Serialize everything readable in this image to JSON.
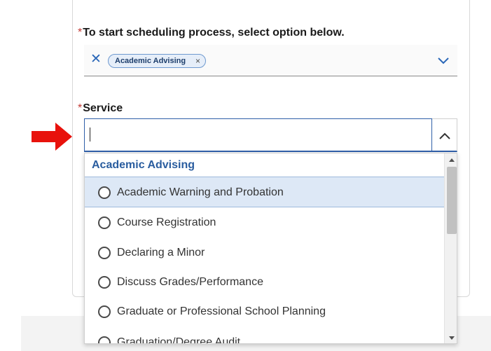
{
  "form": {
    "required_marker": "*",
    "scheduling_label": "To start scheduling process, select option below.",
    "scheduling_selected_chip": "Academic Advising",
    "chip_remove_glyph": "×",
    "clear_glyph": "✕",
    "service_label": "Service",
    "service_input_value": ""
  },
  "dropdown": {
    "group_header": "Academic Advising",
    "options": [
      {
        "label": "Academic Warning and Probation",
        "highlighted": true
      },
      {
        "label": "Course Registration",
        "highlighted": false
      },
      {
        "label": "Declaring a Minor",
        "highlighted": false
      },
      {
        "label": "Discuss Grades/Performance",
        "highlighted": false
      },
      {
        "label": "Graduate or Professional School Planning",
        "highlighted": false
      },
      {
        "label": "Graduation/Degree Audit",
        "highlighted": false
      }
    ]
  },
  "icons": {
    "clear": "close-icon",
    "chip_remove": "close-icon",
    "combo1_toggle": "chevron-down-icon",
    "combo2_toggle": "chevron-up-icon",
    "annotation": "arrow-right-icon",
    "radio": "radio-unchecked-icon"
  },
  "colors": {
    "accent": "#2a67b8",
    "group_header": "#2a5d9f",
    "required": "#c23934",
    "highlight": "#dde8f6",
    "annotation_arrow": "#e8120c"
  }
}
